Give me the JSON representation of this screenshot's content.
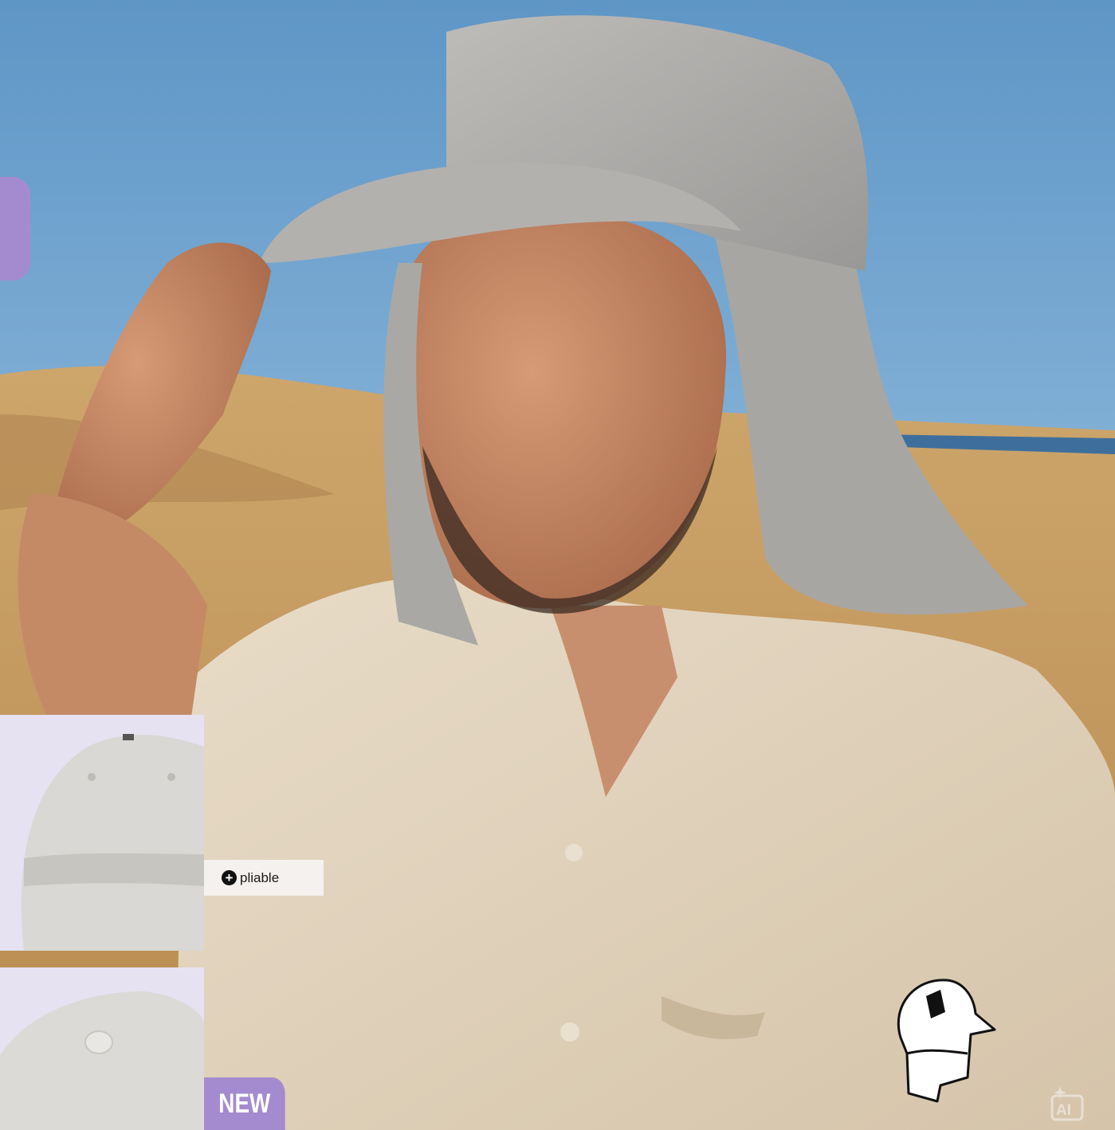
{
  "image": {
    "subject": "man-in-cap-with-neck-flap",
    "background": "desert-dunes"
  },
  "feature_label": {
    "icon": "plus-circle-icon",
    "text": "pliable"
  },
  "badge": {
    "text": "NEW"
  },
  "icons": {
    "cap": "cap-with-neck-flap-icon",
    "ai": "ai-sparkle-icon"
  },
  "colors": {
    "accent": "#a48bcf",
    "label_bg": "#f4f1ee",
    "thumb_bg": "#e6e2f2"
  }
}
